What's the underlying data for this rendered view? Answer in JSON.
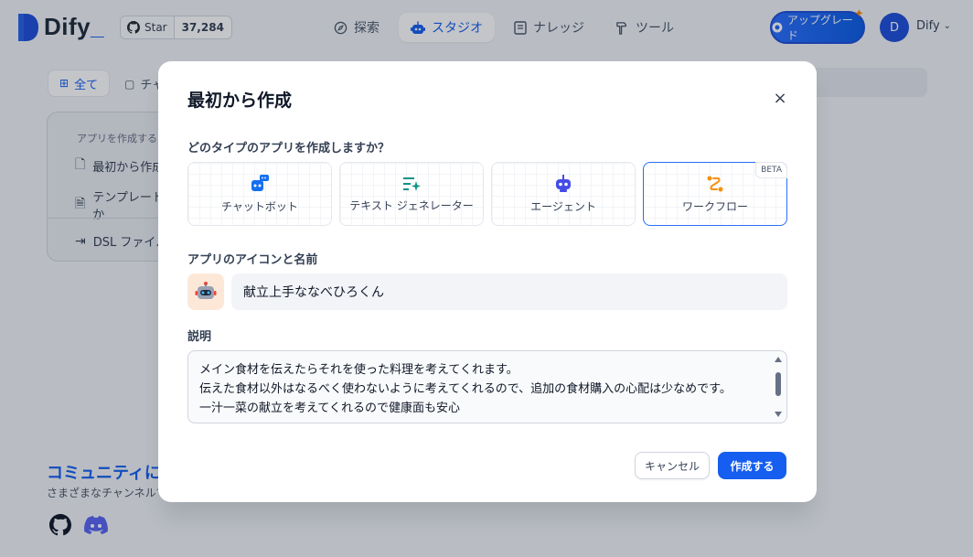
{
  "header": {
    "logo_text": "Dify",
    "logo_suffix": "_",
    "github": {
      "star_label": "Star",
      "count": "37,284",
      "icon": "github-icon"
    },
    "nav": [
      {
        "label": "探索",
        "icon": "compass-icon",
        "active": false
      },
      {
        "label": "スタジオ",
        "icon": "robot-icon",
        "active": true
      },
      {
        "label": "ナレッジ",
        "icon": "book-icon",
        "active": false
      },
      {
        "label": "ツール",
        "icon": "hammer-icon",
        "active": false
      }
    ],
    "upgrade_label": "アップグレード",
    "user": {
      "initial": "D",
      "name": "Dify"
    }
  },
  "background": {
    "tabs": {
      "all": "全て",
      "chat": "チャ"
    },
    "create_card": {
      "title": "アプリを作成する",
      "items": [
        "最初から作成",
        "テンプレートか",
        "DSL ファイル"
      ]
    },
    "community": {
      "title": "コミュニティに参",
      "subtitle": "さまざまなチャンネルで"
    }
  },
  "modal": {
    "title": "最初から作成",
    "type_question": "どのタイプのアプリを作成しますか？",
    "types": [
      {
        "label": "チャットボット",
        "icon": "chatbot-icon",
        "selected": false
      },
      {
        "label": "テキスト ジェネレーター",
        "icon": "text-generator-icon",
        "selected": false
      },
      {
        "label": "エージェント",
        "icon": "agent-icon",
        "selected": false
      },
      {
        "label": "ワークフロー",
        "icon": "workflow-icon",
        "selected": true,
        "badge": "BETA"
      }
    ],
    "name_label": "アプリのアイコンと名前",
    "name_value": "献立上手ななべひろくん",
    "desc_label": "説明",
    "desc_value": "メイン食材を伝えたらそれを使った料理を考えてくれます。\n伝えた食材以外はなるべく使わないように考えてくれるので、追加の食材購入の心配は少なめです。\n一汁一菜の献立を考えてくれるので健康面も安心",
    "cancel_label": "キャンセル",
    "create_label": "作成する"
  },
  "colors": {
    "accent": "#155eef",
    "workflow_icon": "#f79009",
    "chatbot_icon": "#1570ef",
    "agent_icon": "#444ce7",
    "textgen_icon": "#0e9384"
  }
}
